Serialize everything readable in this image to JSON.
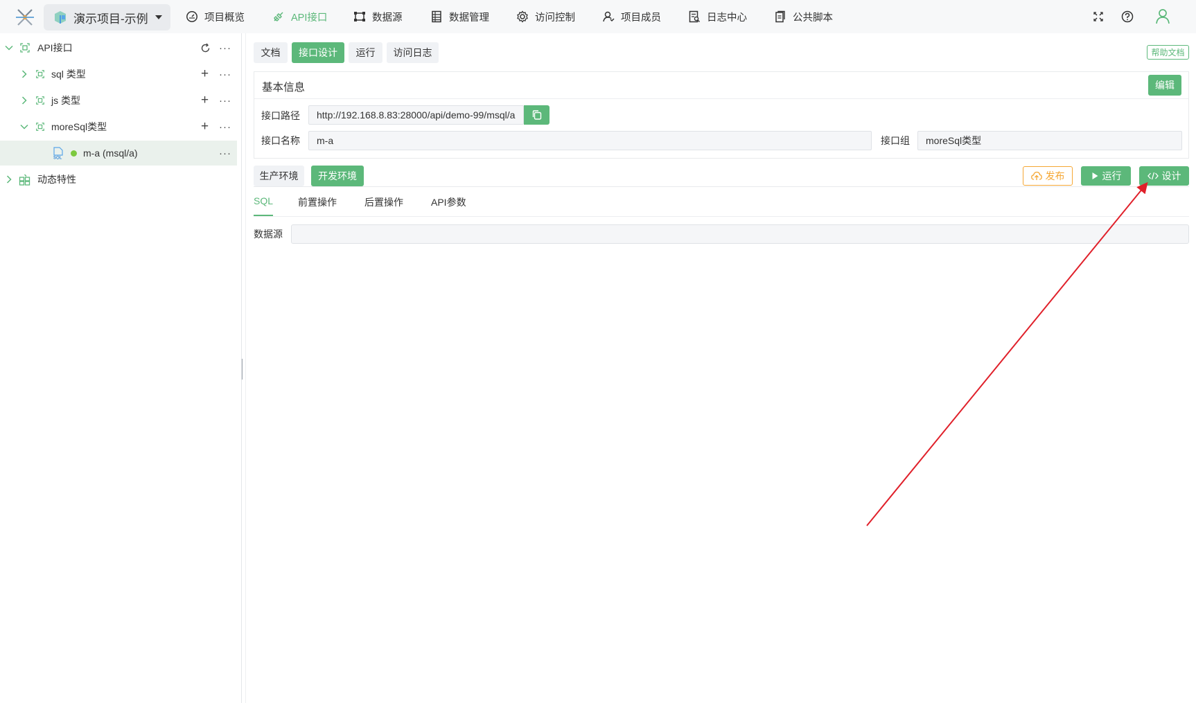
{
  "header": {
    "project_name": "演示项目-示例",
    "nav": [
      {
        "label": "项目概览",
        "icon": "dashboard-icon"
      },
      {
        "label": "API接口",
        "icon": "api-icon"
      },
      {
        "label": "数据源",
        "icon": "datasource-icon"
      },
      {
        "label": "数据管理",
        "icon": "data-management-icon"
      },
      {
        "label": "访问控制",
        "icon": "gear-icon"
      },
      {
        "label": "项目成员",
        "icon": "members-icon"
      },
      {
        "label": "日志中心",
        "icon": "log-icon"
      },
      {
        "label": "公共脚本",
        "icon": "script-icon"
      }
    ],
    "active_nav": "API接口"
  },
  "sidebar": {
    "root": {
      "label": "API接口"
    },
    "items": [
      {
        "label": "sql 类型"
      },
      {
        "label": "js 类型"
      },
      {
        "label": "moreSql类型"
      },
      {
        "label": "m-a (msql/a)"
      },
      {
        "label": "动态特性"
      }
    ]
  },
  "tabs": [
    {
      "label": "文档"
    },
    {
      "label": "接口设计"
    },
    {
      "label": "运行"
    },
    {
      "label": "访问日志"
    }
  ],
  "active_tab": "接口设计",
  "help_label": "帮助文档",
  "basic_info": {
    "title": "基本信息",
    "edit_label": "编辑",
    "path_label": "接口路径",
    "path_value": "http://192.168.8.83:28000/api/demo-99/msql/a",
    "name_label": "接口名称",
    "name_value": "m-a",
    "group_label": "接口组",
    "group_value": "moreSql类型"
  },
  "env_tabs": [
    {
      "label": "生产环境"
    },
    {
      "label": "开发环境"
    }
  ],
  "active_env": "开发环境",
  "actions": {
    "publish": "发布",
    "run": "运行",
    "design": "设计"
  },
  "subtabs": [
    {
      "label": "SQL"
    },
    {
      "label": "前置操作"
    },
    {
      "label": "后置操作"
    },
    {
      "label": "API参数"
    }
  ],
  "active_subtab": "SQL",
  "datasource_label": "数据源",
  "datasource_value": "",
  "colors": {
    "accent": "#5cb87a",
    "publish": "#f5a733",
    "annotation_arrow": "#e0202a",
    "status_dot": "#7cc93f"
  }
}
